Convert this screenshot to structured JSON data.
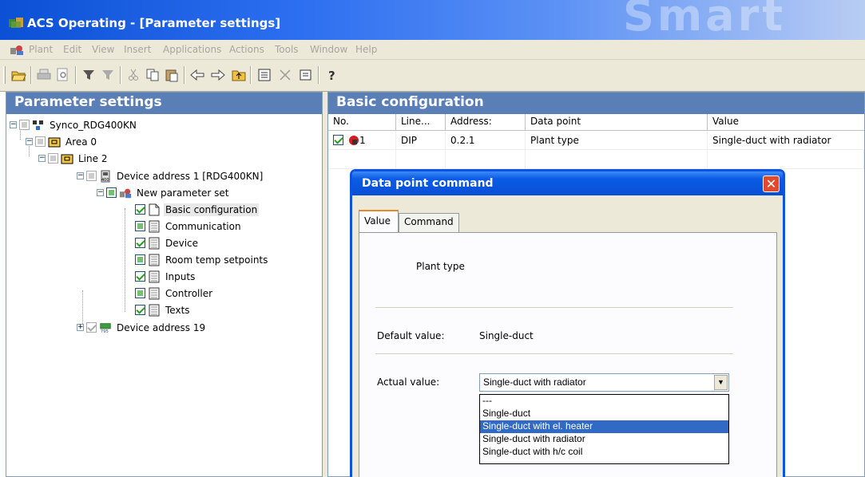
{
  "window": {
    "title": "ACS Operating - [Parameter settings]",
    "watermark": "Smart"
  },
  "menu": [
    "Plant",
    "Edit",
    "View",
    "Insert",
    "Applications",
    "Actions",
    "Tools",
    "Window",
    "Help"
  ],
  "toolbar_icons": [
    "open-icon",
    "print-icon",
    "print-preview-icon",
    "filter-icon",
    "filter-off-icon",
    "cut-icon",
    "copy-icon",
    "paste-icon",
    "back-icon",
    "forward-icon",
    "up-folder-icon",
    "list-view-icon",
    "delete-icon",
    "properties-icon",
    "help-icon"
  ],
  "left_panel": {
    "header": "Parameter settings",
    "tree": [
      {
        "label": "Synco_RDG400KN"
      },
      {
        "label": "Area 0"
      },
      {
        "label": "Line 2"
      },
      {
        "label": "Device address 1 [RDG400KN]"
      },
      {
        "label": "New parameter set"
      },
      {
        "label": "Basic configuration"
      },
      {
        "label": "Communication"
      },
      {
        "label": "Device"
      },
      {
        "label": "Room temp setpoints"
      },
      {
        "label": "Inputs"
      },
      {
        "label": "Controller"
      },
      {
        "label": "Texts"
      },
      {
        "label": "Device address 19"
      }
    ]
  },
  "right_panel": {
    "header": "Basic configuration",
    "columns": [
      "No.",
      "Line...",
      "Address:",
      "Data point",
      "Value"
    ],
    "rows": [
      {
        "no": "1",
        "line": "DIP",
        "address": "0.2.1",
        "data_point": "Plant type",
        "value": "Single-duct with radiator"
      }
    ]
  },
  "dialog": {
    "title": "Data point command",
    "close": "✕",
    "tabs": [
      "Value",
      "Command"
    ],
    "data_point_name": "Plant type",
    "default_label": "Default value:",
    "default_value": "Single-duct",
    "actual_label": "Actual value:",
    "actual_value": "Single-duct with radiator",
    "options": [
      "---",
      "Single-duct",
      "Single-duct with el. heater",
      "Single-duct with radiator",
      "Single-duct with h/c coil"
    ],
    "highlighted_option": "Single-duct with el. heater"
  }
}
